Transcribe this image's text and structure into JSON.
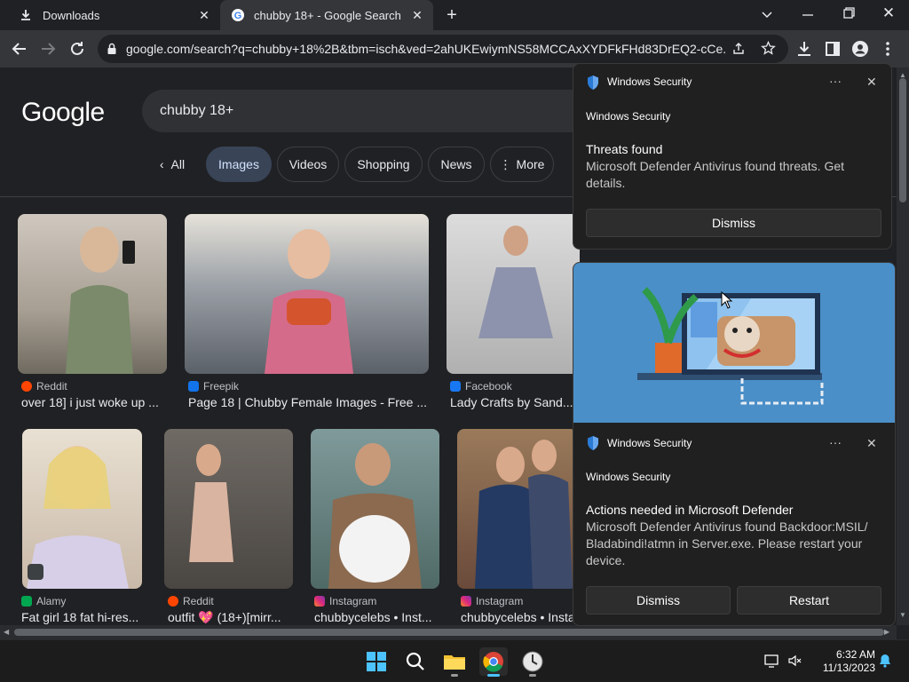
{
  "tabs": [
    {
      "title": "Downloads",
      "icon": "download-icon"
    },
    {
      "title": "chubby 18+ - Google Search",
      "icon": "google-icon"
    }
  ],
  "toolbar": {
    "url": "google.com/search?q=chubby+18%2B&tbm=isch&ved=2ahUKEwiymNS58MCCAxXYDFkFHd83DrEQ2-cCe..."
  },
  "search": {
    "logo": "Google",
    "query": "chubby 18+",
    "chips": [
      "All",
      "Images",
      "Videos",
      "Shopping",
      "News",
      "More"
    ]
  },
  "results": [
    {
      "source": "Reddit",
      "caption": "over 18] i just woke up ...",
      "source_color": "#ff4500"
    },
    {
      "source": "Freepik",
      "caption": "Page 18 | Chubby Female Images - Free ...",
      "source_color": "#1273eb"
    },
    {
      "source": "Facebook",
      "caption": "Lady Crafts by Sand...",
      "source_color": "#1877f2"
    },
    {
      "source": "Alamy",
      "caption": "Fat girl 18 fat hi-res...",
      "source_color": "#00a650"
    },
    {
      "source": "Reddit",
      "caption": "outfit 💖 (18+)[mirr...",
      "source_color": "#ff4500"
    },
    {
      "source": "Instagram",
      "caption": "chubbycelebs • Inst...",
      "source_color": "#e1306c"
    },
    {
      "source": "Instagram",
      "caption": "chubbycelebs • Insta",
      "source_color": "#e1306c"
    }
  ],
  "toast1": {
    "app": "Windows Security",
    "subtitle": "Windows Security",
    "heading": "Threats found",
    "body": "Microsoft Defender Antivirus found threats. Get details.",
    "dismiss": "Dismiss",
    "more": "···",
    "close": "✕"
  },
  "toast2": {
    "app": "Windows Security",
    "subtitle": "Windows Security",
    "heading": "Actions needed in Microsoft Defender",
    "body": "Microsoft Defender Antivirus found Backdoor:MSIL/ Bladabindi!atmn in Server.exe. Please restart your device.",
    "dismiss": "Dismiss",
    "restart": "Restart",
    "more": "···",
    "close": "✕"
  },
  "taskbar": {
    "time": "6:32 AM",
    "date": "11/13/2023"
  },
  "colors": {
    "chrome_bg": "#202124",
    "toolbar_bg": "#35363a",
    "accent_blue": "#0078d4"
  }
}
